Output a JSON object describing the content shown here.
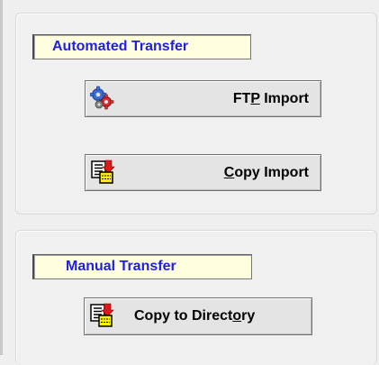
{
  "automated_transfer": {
    "title": "Automated Transfer",
    "ftp_import": {
      "label_before": "FT",
      "mnemonic": "P",
      "label_after": " Import",
      "icon": "gears-icon"
    },
    "copy_import": {
      "label_before": "",
      "mnemonic": "C",
      "label_after": "opy Import",
      "icon": "copy-import-icon"
    }
  },
  "manual_transfer": {
    "title": "Manual Transfer",
    "copy_to_directory": {
      "label_before": "Copy to Direct",
      "mnemonic": "o",
      "label_after": "ry",
      "icon": "copy-to-directory-icon"
    }
  },
  "colors": {
    "label_text": "#1f1fe0",
    "label_background": "#ffffdf",
    "window_background": "#efefef",
    "button_face": "#e4e4e4"
  }
}
